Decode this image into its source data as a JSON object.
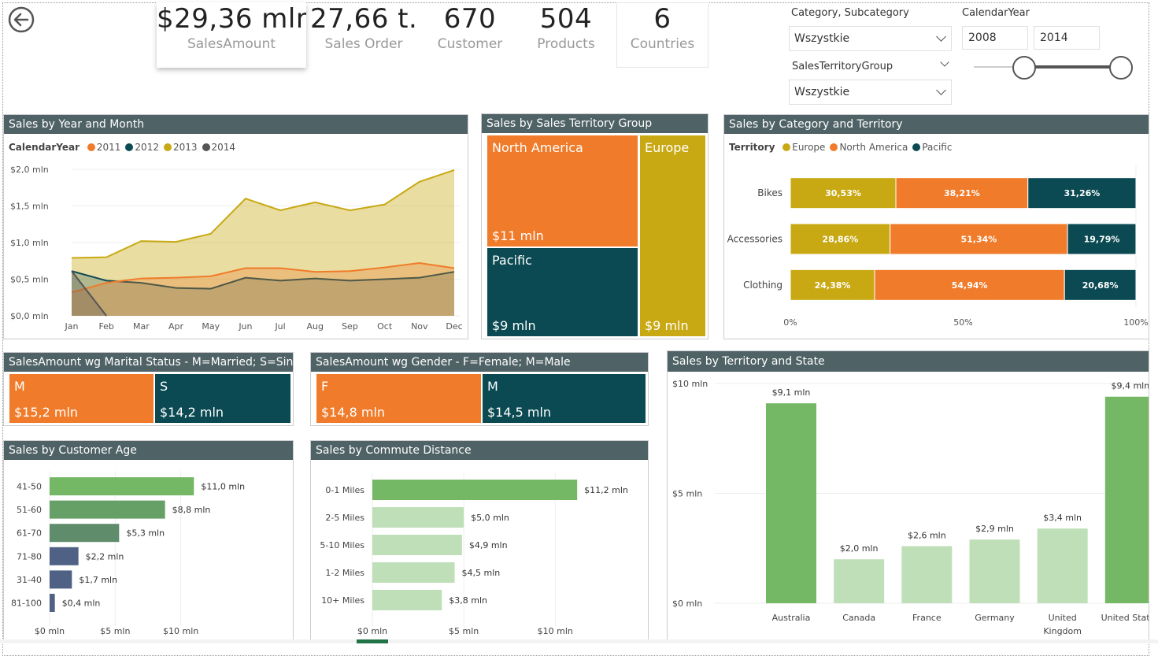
{
  "colors": {
    "orange": "#f07b2a",
    "teal": "#0b4a53",
    "olive": "#c8a914",
    "darkgray": "#555555",
    "header": "#4f6266",
    "green": "#74b866",
    "lightgreen": "#bfdfb9",
    "navy": "#4f6185",
    "sage": "#5f8c6a"
  },
  "kpis": [
    {
      "value": "$29,36 mln",
      "label": "SalesAmount"
    },
    {
      "value": "27,66 t...",
      "label": "Sales Order"
    },
    {
      "value": "670",
      "label": "Customer"
    },
    {
      "value": "504",
      "label": "Products"
    },
    {
      "value": "6",
      "label": "Countries"
    }
  ],
  "slicers": {
    "category_label": "Category, Subcategory",
    "category_value": "Wszystkie",
    "territory_label": "SalesTerritoryGroup",
    "territory_value": "Wszystkie",
    "year_label": "CalendarYear",
    "year_from": "2008",
    "year_to": "2014"
  },
  "nav": {
    "back_icon": "back-arrow-icon"
  },
  "year_month": {
    "title": "Sales by Year and Month",
    "legend_title": "CalendarYear",
    "chart_data": {
      "type": "area",
      "x": [
        "Jan",
        "Feb",
        "Mar",
        "Apr",
        "May",
        "Jun",
        "Jul",
        "Aug",
        "Sep",
        "Oct",
        "Nov",
        "Dec"
      ],
      "ylim": [
        0,
        2.0
      ],
      "yticks": [
        "$0,0 mln",
        "$0,5 mln",
        "$1,0 mln",
        "$1,5 mln",
        "$2,0 mln"
      ],
      "series": [
        {
          "name": "2013",
          "color": "#c8a914",
          "values": [
            0.79,
            0.8,
            1.02,
            1.01,
            1.12,
            1.6,
            1.44,
            1.55,
            1.44,
            1.52,
            1.83,
            1.99
          ]
        },
        {
          "name": "2012",
          "color": "#0b4a53",
          "values": [
            0.61,
            0.48,
            0.45,
            0.38,
            0.37,
            0.52,
            0.48,
            0.51,
            0.48,
            0.5,
            0.52,
            0.6
          ]
        },
        {
          "name": "2011",
          "color": "#f07b2a",
          "values": [
            0.32,
            0.45,
            0.51,
            0.52,
            0.54,
            0.65,
            0.65,
            0.6,
            0.61,
            0.66,
            0.72,
            0.65
          ]
        },
        {
          "name": "2014",
          "color": "#555555",
          "values": [
            0.61,
            0.0,
            null,
            null,
            null,
            null,
            null,
            null,
            null,
            null,
            null,
            null
          ]
        }
      ],
      "legend_order": [
        "2011",
        "2012",
        "2013",
        "2014"
      ]
    }
  },
  "territory_group": {
    "title": "Sales by Sales Territory Group",
    "tiles": [
      {
        "name": "North America",
        "value": "$11 mln",
        "color": "#f07b2a"
      },
      {
        "name": "Pacific",
        "value": "$9 mln",
        "color": "#0b4a53"
      },
      {
        "name": "Europe",
        "value": "$9 mln",
        "color": "#c8a914"
      }
    ]
  },
  "category_territory": {
    "title": "Sales by Category and Territory",
    "legend_title": "Territory",
    "chart_data": {
      "type": "bar",
      "stacked": "100%",
      "categories": [
        "Bikes",
        "Accessories",
        "Clothing"
      ],
      "series": [
        {
          "name": "Europe",
          "color": "#c8a914",
          "values": [
            30.53,
            28.86,
            24.38
          ],
          "labels": [
            "30,53%",
            "28,86%",
            "24,38%"
          ]
        },
        {
          "name": "North America",
          "color": "#f07b2a",
          "values": [
            38.21,
            51.34,
            54.94
          ],
          "labels": [
            "38,21%",
            "51,34%",
            "54,94%"
          ]
        },
        {
          "name": "Pacific",
          "color": "#0b4a53",
          "values": [
            31.26,
            19.79,
            20.68
          ],
          "labels": [
            "31,26%",
            "19,79%",
            "20,68%"
          ]
        }
      ],
      "xticks": [
        "0%",
        "50%",
        "100%"
      ]
    }
  },
  "marital": {
    "title": "SalesAmount wg Marital Status - M=Married; S=Sin...",
    "tiles": [
      {
        "name": "M",
        "value": "$15,2 mln",
        "color": "#f07b2a"
      },
      {
        "name": "S",
        "value": "$14,2 mln",
        "color": "#0b4a53"
      }
    ]
  },
  "gender": {
    "title": "SalesAmount wg Gender - F=Female; M=Male",
    "tiles": [
      {
        "name": "F",
        "value": "$14,8 mln",
        "color": "#f07b2a"
      },
      {
        "name": "M",
        "value": "$14,5 mln",
        "color": "#0b4a53"
      }
    ]
  },
  "age": {
    "title": "Sales by Customer Age",
    "chart_data": {
      "type": "bar",
      "categories": [
        "41-50",
        "51-60",
        "61-70",
        "71-80",
        "31-40",
        "81-100"
      ],
      "values": [
        11.0,
        8.8,
        5.3,
        2.2,
        1.7,
        0.4
      ],
      "labels": [
        "$11,0 mln",
        "$8,8 mln",
        "$5,3 mln",
        "$2,2 mln",
        "$1,7 mln",
        "$0,4 mln"
      ],
      "colors": [
        "#74b866",
        "#66a067",
        "#5f8c6a",
        "#4f6185",
        "#4f6185",
        "#4f6185"
      ],
      "xlim": [
        0,
        12
      ],
      "xticks": [
        {
          "v": 0,
          "t": "$0 mln"
        },
        {
          "v": 5,
          "t": "$5 mln"
        },
        {
          "v": 10,
          "t": "$10 mln"
        }
      ]
    }
  },
  "commute": {
    "title": "Sales by Commute Distance",
    "chart_data": {
      "type": "bar",
      "categories": [
        "0-1 Miles",
        "2-5 Miles",
        "5-10 Miles",
        "1-2 Miles",
        "10+ Miles"
      ],
      "values": [
        11.2,
        5.0,
        4.9,
        4.5,
        3.8
      ],
      "labels": [
        "$11,2 mln",
        "$5,0 mln",
        "$4,9 mln",
        "$4,5 mln",
        "$3,8 mln"
      ],
      "colors": [
        "#74b866",
        "#bfdfb9",
        "#bfdfb9",
        "#bfdfb9",
        "#bfdfb9"
      ],
      "xlim": [
        0,
        13
      ],
      "xticks": [
        {
          "v": 0,
          "t": "$0 mln"
        },
        {
          "v": 5,
          "t": "$5 mln"
        },
        {
          "v": 10,
          "t": "$10 mln"
        }
      ]
    }
  },
  "state": {
    "title": "Sales by Territory and State",
    "chart_data": {
      "type": "bar",
      "categories": [
        "Australia",
        "Canada",
        "France",
        "Germany",
        "United Kingdom",
        "United States"
      ],
      "category_lines": [
        [
          "Australia"
        ],
        [
          "Canada"
        ],
        [
          "France"
        ],
        [
          "Germany"
        ],
        [
          "United",
          "Kingdom"
        ],
        [
          "United States"
        ]
      ],
      "values": [
        9.1,
        2.0,
        2.6,
        2.9,
        3.4,
        9.4
      ],
      "labels": [
        "$9,1 mln",
        "$2,0 mln",
        "$2,6 mln",
        "$2,9 mln",
        "$3,4 mln",
        "$9,4 mln"
      ],
      "colors": [
        "#74b866",
        "#bfdfb9",
        "#bfdfb9",
        "#bfdfb9",
        "#bfdfb9",
        "#74b866"
      ],
      "ylim": [
        0,
        10
      ],
      "yticks": [
        {
          "v": 0,
          "t": "$0 mln"
        },
        {
          "v": 5,
          "t": "$5 mln"
        },
        {
          "v": 10,
          "t": "$10 mln"
        }
      ]
    }
  }
}
